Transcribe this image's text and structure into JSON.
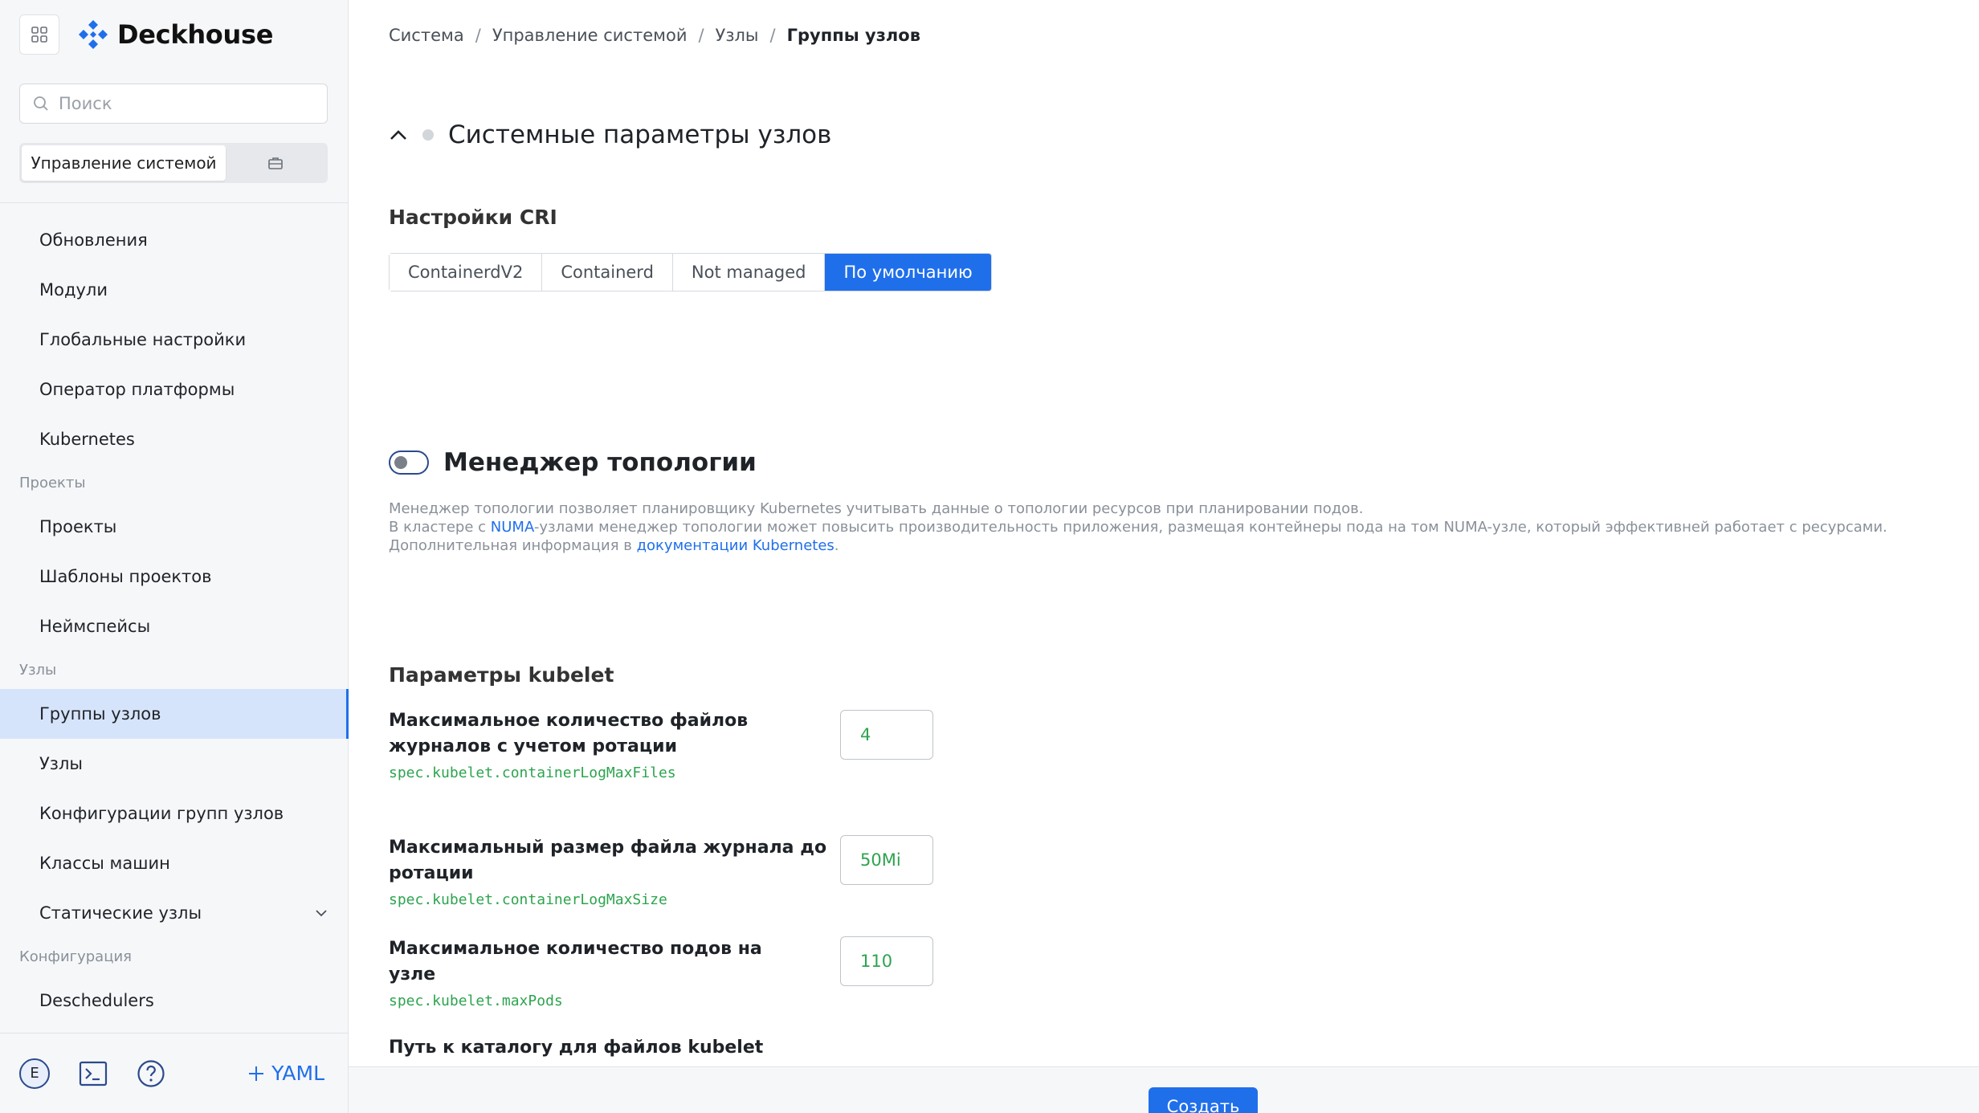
{
  "app": {
    "name": "Deckhouse"
  },
  "colors": {
    "accent": "#1f6feb",
    "path_green": "#2da44e",
    "active_nav_bg": "#d6e4fb"
  },
  "sidebar": {
    "search_placeholder": "Поиск",
    "scope_selected": "Управление системой",
    "nav": [
      {
        "type": "item",
        "label": "Обновления"
      },
      {
        "type": "item",
        "label": "Модули"
      },
      {
        "type": "item",
        "label": "Глобальные настройки"
      },
      {
        "type": "item",
        "label": "Оператор платформы"
      },
      {
        "type": "item",
        "label": "Kubernetes"
      },
      {
        "type": "group",
        "label": "Проекты"
      },
      {
        "type": "item",
        "label": "Проекты"
      },
      {
        "type": "item",
        "label": "Шаблоны проектов"
      },
      {
        "type": "item",
        "label": "Неймспейсы"
      },
      {
        "type": "group",
        "label": "Узлы"
      },
      {
        "type": "item",
        "label": "Группы узлов",
        "active": true
      },
      {
        "type": "item",
        "label": "Узлы"
      },
      {
        "type": "item",
        "label": "Конфигурации групп узлов"
      },
      {
        "type": "item",
        "label": "Классы машин"
      },
      {
        "type": "item",
        "label": "Статические узлы",
        "expandable": true
      },
      {
        "type": "group",
        "label": "Конфигурация"
      },
      {
        "type": "item",
        "label": "Deschedulers"
      }
    ],
    "footer": {
      "avatar_letter": "E",
      "yaml_label": "YAML"
    }
  },
  "breadcrumb": [
    "Система",
    "Управление системой",
    "Узлы",
    "Группы узлов"
  ],
  "section": {
    "title": "Системные параметры узлов"
  },
  "cri": {
    "title": "Настройки CRI",
    "options": [
      "ContainerdV2",
      "Containerd",
      "Not managed",
      "По умолчанию"
    ],
    "selected": "По умолчанию"
  },
  "topology": {
    "title": "Менеджер топологии",
    "enabled": false,
    "desc_line1": "Менеджер топологии позволяет планировщику Kubernetes учитывать данные о топологии ресурсов при планировании подов.",
    "desc_line2_a": "В кластере с ",
    "desc_line2_link": "NUMA",
    "desc_line2_b": "-узлами менеджер топологии может повысить производительность приложения, размещая контейнеры пода на том NUMA-узле, который эффективней работает с ресурсами.",
    "desc_line3_a": "Дополнительная информация в ",
    "desc_line3_link": "документации Kubernetes",
    "desc_line3_b": "."
  },
  "kubelet": {
    "title": "Параметры kubelet",
    "fields": [
      {
        "label": "Максимальное количество файлов журналов с учетом ротации",
        "path": "spec.kubelet.containerLogMaxFiles",
        "value": "4"
      },
      {
        "label": "Максимальный размер файла журнала до ротации",
        "path": "spec.kubelet.containerLogMaxSize",
        "value": "50Mi"
      },
      {
        "label": "Максимальное количество подов на узле",
        "path": "spec.kubelet.maxPods",
        "value": "110"
      }
    ],
    "partial_label": "Путь к каталогу для файлов kubelet"
  },
  "actions": {
    "create_label": "Создать"
  }
}
